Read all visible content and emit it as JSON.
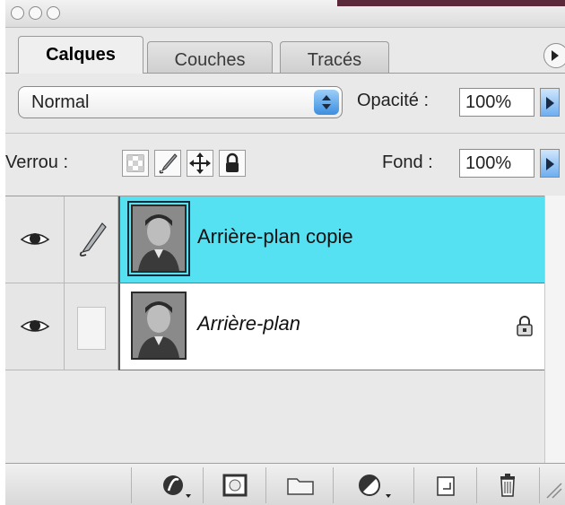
{
  "tabs": [
    {
      "label": "Calques",
      "active": true
    },
    {
      "label": "Couches",
      "active": false
    },
    {
      "label": "Tracés",
      "active": false
    }
  ],
  "blend": {
    "mode": "Normal",
    "opacity_label": "Opacité :",
    "opacity_value": "100%"
  },
  "lock": {
    "label": "Verrou :",
    "fill_label": "Fond :",
    "fill_value": "100%"
  },
  "layers": [
    {
      "name": "Arrière-plan copie",
      "selected": true,
      "italic": false,
      "visible": true,
      "linked_icon": "brush-icon",
      "locked": false
    },
    {
      "name": "Arrière-plan",
      "selected": false,
      "italic": true,
      "visible": true,
      "linked_icon": "",
      "locked": true
    }
  ],
  "colors": {
    "selection": "#56e1f2",
    "panel": "#e9e9e9",
    "accent_button": "#3c8ee0"
  },
  "toolbar_icons": [
    "layer-style-icon",
    "layer-mask-icon",
    "new-group-icon",
    "adjustment-layer-icon",
    "new-layer-icon",
    "trash-icon"
  ]
}
